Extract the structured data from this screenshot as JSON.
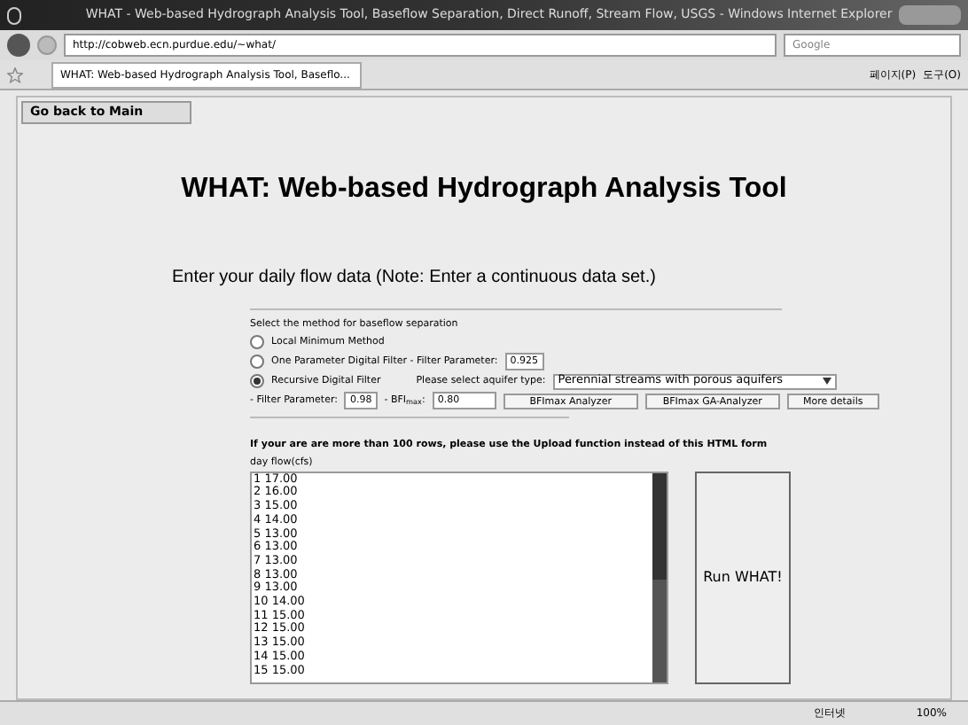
{
  "window": {
    "title": "WHAT - Web-based Hydrograph Analysis Tool, Baseflow Separation, Direct Runoff, Stream Flow, USGS - Windows Internet Explorer"
  },
  "address_bar": {
    "url": "http://cobweb.ecn.purdue.edu/~what/"
  },
  "search": {
    "placeholder": "Google"
  },
  "tab": {
    "label": "WHAT: Web-based Hydrograph Analysis Tool, Baseflo..."
  },
  "command_bar": {
    "page": "페이지(P)",
    "tools": "도구(O)"
  },
  "page": {
    "back_button": "Go back to Main",
    "heading": "WHAT: Web-based Hydrograph Analysis Tool",
    "instruction": "Enter your daily flow data (Note: Enter a continuous data set.)",
    "method_label": "Select the method for baseflow separation",
    "methods": [
      {
        "label": "Local Minimum Method",
        "selected": false
      },
      {
        "label": "One Parameter Digital Filter - Filter Parameter:",
        "selected": false,
        "value": "0.925"
      },
      {
        "label": "Recursive Digital Filter",
        "selected": true
      }
    ],
    "aquifer_label": "Please select aquifer type:",
    "aquifer_value": "Perennial streams with porous aquifers",
    "filter_label": "- Filter Parameter:",
    "filter_value": "0.98",
    "bfi_label": "- BFI",
    "bfi_sub": "max",
    "bfi_colon": ":",
    "bfi_value": "0.80",
    "buttons": [
      "BFImax Analyzer",
      "BFImax GA-Analyzer",
      "More details"
    ],
    "note": "If your are are more than 100 rows, please use the Upload function instead of this HTML form",
    "column_label": "day flow(cfs)",
    "data_lines": [
      "1 17.00",
      "2 16.00",
      "3 15.00",
      "4 14.00",
      "5 13.00",
      "6 13.00",
      "7 13.00",
      "8 13.00",
      "9 13.00",
      "10 14.00",
      "11 15.00",
      "12 15.00",
      "13 15.00",
      "14 15.00",
      "15 15.00"
    ],
    "run_button": "Run WHAT!"
  },
  "status_bar": {
    "zone": "인터넷",
    "zoom": "100%"
  }
}
